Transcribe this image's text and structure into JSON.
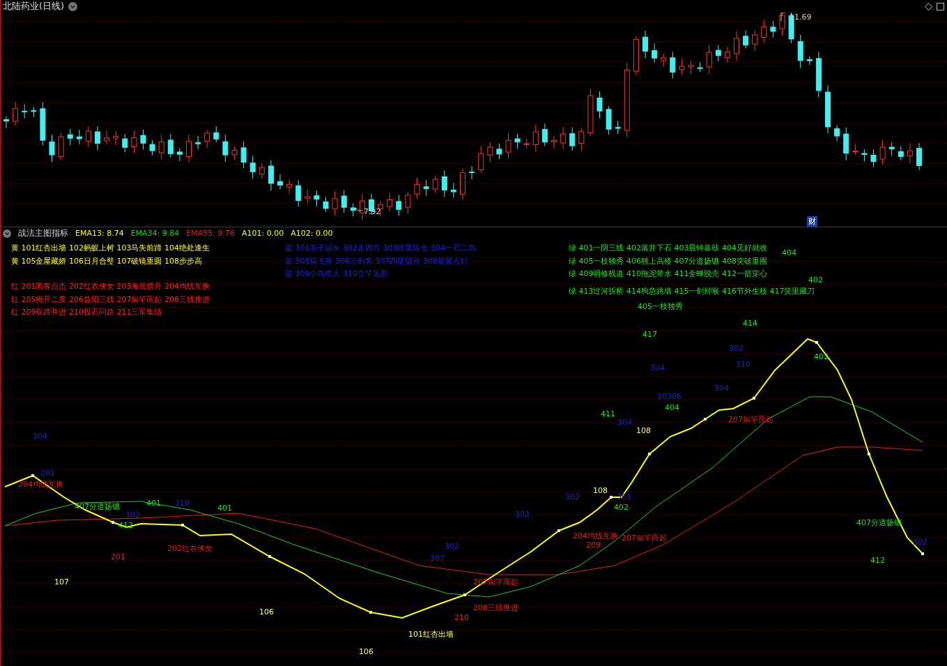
{
  "window": {
    "title": "北陆药业(日线)"
  },
  "price_chart": {
    "high_label": "11.69",
    "low_label": "7.92",
    "badge": "财"
  },
  "indicator": {
    "title": "战法主图指标",
    "values": [
      {
        "text": "EMA13: 8.74",
        "color": "#ffff00"
      },
      {
        "text": "EMA34: 9.84",
        "color": "#00e000"
      },
      {
        "text": "EMA55: 9.76",
        "color": "#e02020"
      },
      {
        "text": "A101: 0.00",
        "color": "#ffff00"
      },
      {
        "text": "A102: 0.00",
        "color": "#ffff00"
      }
    ]
  },
  "legend": [
    {
      "color": "#ffff00",
      "lines": [
        "黄 101红杏出墙 102蚂蚁上树 103马失前蹄 104绝处逢生",
        "黄 105金屋藏娇 106日月合璧 107破镜重圆 108步步高"
      ]
    },
    {
      "color": "#ff2020",
      "lines": [
        "红 201黑客点击 202红衣侠女 203海底捞月 204均线互换",
        "红 205梅开二度 206益阳三线 207揭竿而起 208三线推进",
        "红 209双蹄并进 210投石问路 211三军集结"
      ]
    },
    {
      "color": "#2020e0",
      "lines": [
        "蓝 301浪子回头 302走四方 303暗度陈仓 304一石二鸟",
        "蓝 305双飞燕 306三剑客 307四星望月 308星星点灯",
        "蓝 309小鸟依人 310立竿见影"
      ]
    },
    {
      "color": "#20e020",
      "lines": [
        "绿 401一阴三线 402落井下石 403晨钟暮鼓 404见好就收",
        "绿 405一枝独秀 406独上高楼 407分道扬镳 408突破重围",
        "绿 409明修栈道 410拖泥带水 411金蝉脱壳 412一箭穿心",
        "绿 413过河拆桥 414狗急跳墙 415一剑封喉 416节外生枝 417笑里藏刀"
      ]
    }
  ],
  "signals": [
    {
      "text": "304",
      "color": "#2020c0"
    },
    {
      "text": "201",
      "color": "#2020c0"
    },
    {
      "text": "204均线互换",
      "color": "#e02020"
    },
    {
      "text": "407分道扬镳",
      "color": "#20e020"
    },
    {
      "text": "401",
      "color": "#20e020"
    },
    {
      "text": "310",
      "color": "#2020c0"
    },
    {
      "text": "401",
      "color": "#20e020"
    },
    {
      "text": "302",
      "color": "#2020c0"
    },
    {
      "text": "412",
      "color": "#20e020"
    },
    {
      "text": "201",
      "color": "#e02020"
    },
    {
      "text": "202红衣侠女",
      "color": "#e02020"
    },
    {
      "text": "107",
      "color": "#ffff60"
    },
    {
      "text": "106",
      "color": "#ffff60"
    },
    {
      "text": "106",
      "color": "#ffff60"
    },
    {
      "text": "101红杏出墙",
      "color": "#ffff60"
    },
    {
      "text": "302",
      "color": "#2020c0"
    },
    {
      "text": "307",
      "color": "#2020c0"
    },
    {
      "text": "210",
      "color": "#e02020"
    },
    {
      "text": "207揭竿而起",
      "color": "#e02020"
    },
    {
      "text": "208三线推进",
      "color": "#e02020"
    },
    {
      "text": "302",
      "color": "#2020c0"
    },
    {
      "text": "302",
      "color": "#2020c0"
    },
    {
      "text": "108",
      "color": "#ffff60"
    },
    {
      "text": "301",
      "color": "#2020c0"
    },
    {
      "text": "402",
      "color": "#20e020"
    },
    {
      "text": "204均线互换",
      "color": "#e02020"
    },
    {
      "text": "209",
      "color": "#e02020"
    },
    {
      "text": "207揭竿而起",
      "color": "#e02020"
    },
    {
      "text": "411",
      "color": "#20e020"
    },
    {
      "text": "304",
      "color": "#2020c0"
    },
    {
      "text": "108",
      "color": "#ffff60"
    },
    {
      "text": "30306",
      "color": "#2020c0"
    },
    {
      "text": "404",
      "color": "#20e020"
    },
    {
      "text": "304",
      "color": "#2020c0"
    },
    {
      "text": "417",
      "color": "#20e020"
    },
    {
      "text": "414",
      "color": "#20e020"
    },
    {
      "text": "302",
      "color": "#2020c0"
    },
    {
      "text": "310",
      "color": "#2020c0"
    },
    {
      "text": "304",
      "color": "#2020c0"
    },
    {
      "text": "207揭竿而起",
      "color": "#e02020"
    },
    {
      "text": "402",
      "color": "#20e020"
    },
    {
      "text": "407分道扬镳",
      "color": "#20e020"
    },
    {
      "text": "302",
      "color": "#2020c0"
    },
    {
      "text": "412",
      "color": "#20e020"
    },
    {
      "text": "402",
      "color": "#20e020"
    },
    {
      "text": "405一枝独秀",
      "color": "#20e020"
    },
    {
      "text": "404",
      "color": "#20e020"
    }
  ]
}
